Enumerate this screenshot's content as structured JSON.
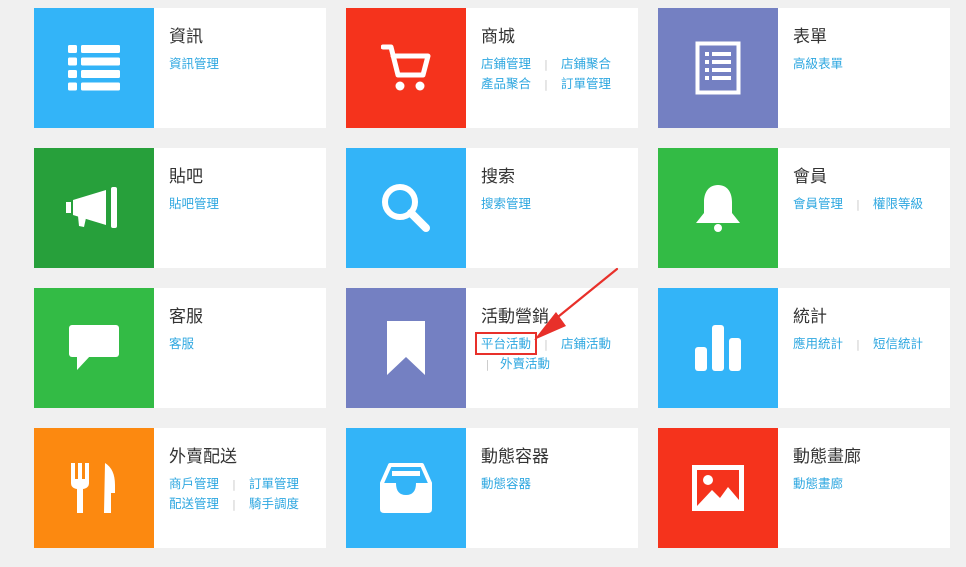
{
  "colors": {
    "page_bg": "#f0f0f0",
    "link": "#2ea7e0",
    "sky_blue": "#33b4f8",
    "red": "#f5331c",
    "slate_purple": "#7480c2",
    "dark_green": "#27a03b",
    "green": "#33bb45",
    "orange": "#fc8910",
    "annotation_red": "#e8302a"
  },
  "modules": [
    {
      "title": "資訊",
      "icon": "list-icon",
      "color": "#33b4f8",
      "links": [
        [
          "資訊管理"
        ]
      ]
    },
    {
      "title": "商城",
      "icon": "shopping-cart-icon",
      "color": "#f5331c",
      "links": [
        [
          "店鋪管理",
          "店鋪聚合"
        ],
        [
          "產品聚合",
          "訂單管理"
        ]
      ]
    },
    {
      "title": "表單",
      "icon": "form-document-icon",
      "color": "#7480c2",
      "links": [
        [
          "高級表單"
        ]
      ]
    },
    {
      "title": "貼吧",
      "icon": "megaphone-icon",
      "color": "#27a03b",
      "links": [
        [
          "貼吧管理"
        ]
      ]
    },
    {
      "title": "搜索",
      "icon": "magnifier-icon",
      "color": "#33b4f8",
      "links": [
        [
          "搜索管理"
        ]
      ]
    },
    {
      "title": "會員",
      "icon": "bell-icon",
      "color": "#33bb45",
      "links": [
        [
          "會員管理",
          "權限等級"
        ]
      ]
    },
    {
      "title": "客服",
      "icon": "chat-bubble-icon",
      "color": "#33bb45",
      "links": [
        [
          "客服"
        ]
      ]
    },
    {
      "title": "活動營銷",
      "icon": "bookmark-icon",
      "color": "#7480c2",
      "links": [
        [
          "平台活動",
          "店鋪活動"
        ],
        [
          "外賣活動"
        ]
      ]
    },
    {
      "title": "統計",
      "icon": "bar-chart-icon",
      "color": "#33b4f8",
      "links": [
        [
          "應用統計",
          "短信統計"
        ]
      ]
    },
    {
      "title": "外賣配送",
      "icon": "fork-knife-icon",
      "color": "#fc8910",
      "links": [
        [
          "商戶管理",
          "訂單管理"
        ],
        [
          "配送管理",
          "騎手調度"
        ]
      ]
    },
    {
      "title": "動態容器",
      "icon": "inbox-tray-icon",
      "color": "#33b4f8",
      "links": [
        [
          "動態容器"
        ]
      ]
    },
    {
      "title": "動態畫廊",
      "icon": "picture-icon",
      "color": "#f5331c",
      "links": [
        [
          "動態畫廊"
        ]
      ]
    }
  ]
}
